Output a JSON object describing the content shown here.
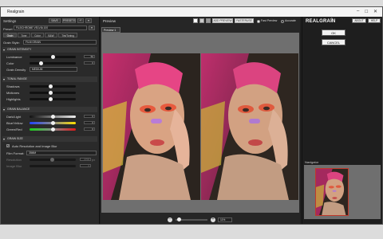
{
  "app_title": "Realgrain",
  "settings": {
    "label": "Settings",
    "save": "SAVE",
    "presets": "PRESETS",
    "preset_label": "Preset",
    "preset_value": "FUJICHROME VELVIA 100",
    "tabs": [
      "Grain",
      "Tone",
      "Color",
      "B&W",
      "Tint/Toning"
    ],
    "grain_style_label": "Grain Style:",
    "grain_style_value": "FILM GRAIN",
    "sections": {
      "intensity": "GRAIN INTENSITY",
      "tonal": "TONAL RANGE",
      "balance": "GRAIN BALANCE",
      "size": "GRAIN SIZE"
    },
    "intensity": {
      "luminance_label": "Luminance",
      "luminance_value": "50",
      "color_label": "Color",
      "color_value": "0",
      "density_label": "Grain Density",
      "density_value": "MEDIUM"
    },
    "tonal": {
      "shadows": "Shadows",
      "midtones": "Midtones",
      "highlights": "Highlights"
    },
    "balance": {
      "dark_light": "Dark/Light",
      "blue_yellow": "Blue/Yellow",
      "green_red": "Green/Red",
      "values": [
        "0",
        "0",
        "0"
      ]
    },
    "size": {
      "auto_label": "Auto Resolution and Image Blur",
      "film_format_label": "Film Format:",
      "film_format_value": "35MM",
      "resolution_label": "Resolution",
      "resolution_value": "2700",
      "resolution_unit": "px",
      "blur_label": "Image Blur",
      "blur_value": "0"
    }
  },
  "preview": {
    "label": "Preview",
    "tab": "Preview 1",
    "add_preview": "ADD PREVIEW",
    "mode": "FASTERUSE",
    "radio_fast": "Fast Preview",
    "radio_accurate": "Accurate",
    "zoom_value": "11%"
  },
  "brand": {
    "name": "REALGRAIN",
    "version": "2",
    "about": "ABOUT",
    "help": "HELP"
  },
  "dialog": {
    "ok": "OK",
    "cancel": "CANCEL"
  },
  "navigator": {
    "label": "Navigator"
  },
  "slider_levels": {
    "luminance": 0.5,
    "color": 0.25,
    "shadows": 0.45,
    "midtones": 0.45,
    "highlights": 0.45,
    "dark_light": 0.5,
    "blue_yellow": 0.5,
    "green_red": 0.5
  },
  "colors": {
    "panel": "#2a2a2a",
    "accent": "#ffffff",
    "track_dark": "#111111"
  }
}
